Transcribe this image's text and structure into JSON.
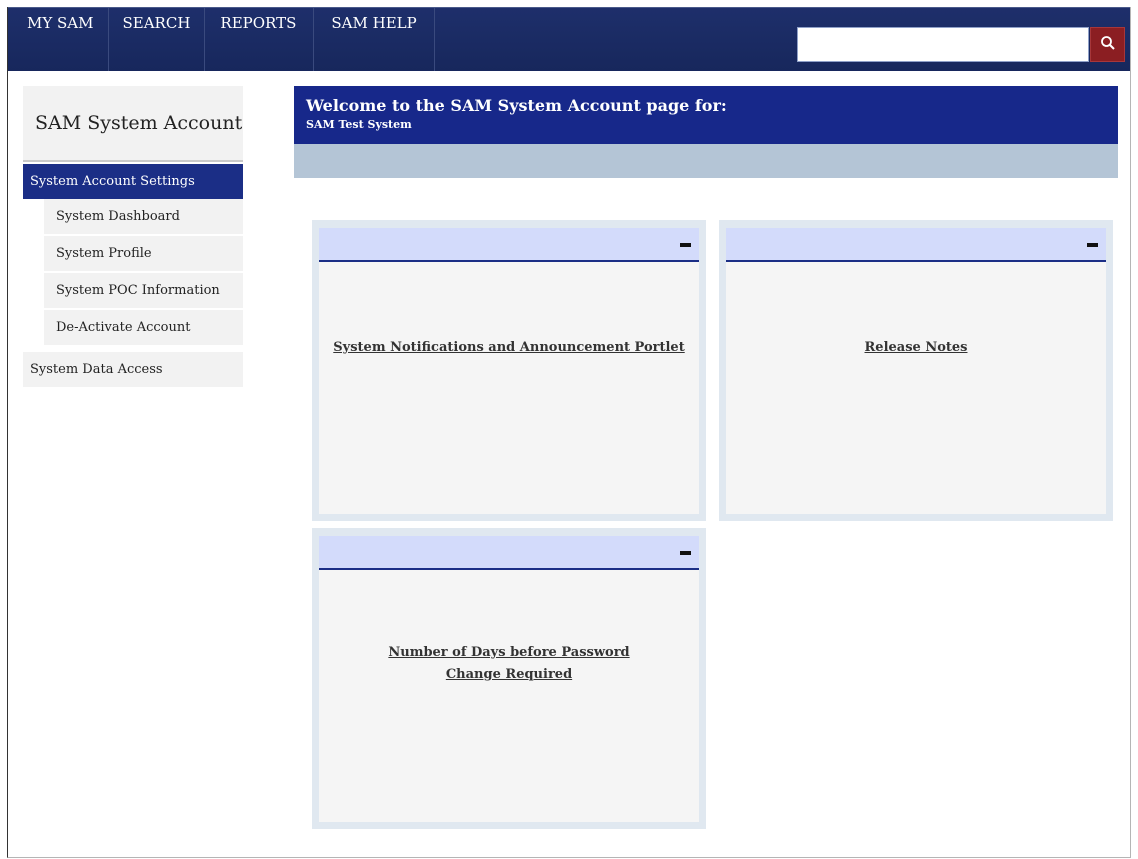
{
  "nav": {
    "items": [
      {
        "label": "MY SAM"
      },
      {
        "label": "SEARCH"
      },
      {
        "label": "REPORTS"
      },
      {
        "label": "SAM HELP"
      }
    ],
    "active_index": 0
  },
  "search": {
    "placeholder": "",
    "value": "",
    "icon": "search-icon"
  },
  "sidebar": {
    "title": "SAM System Account",
    "section_active": "System Account Settings",
    "sub_items": [
      {
        "label": "System Dashboard"
      },
      {
        "label": "System Profile"
      },
      {
        "label": "System POC Information"
      },
      {
        "label": "De-Activate Account"
      }
    ],
    "section_other": "System Data Access"
  },
  "welcome": {
    "heading": "Welcome to the SAM System Account page for:",
    "system_name": "SAM Test System"
  },
  "portlets": [
    {
      "title": "System Notifications and Announcement Portlet"
    },
    {
      "title": "Release Notes"
    },
    {
      "title": "Number of Days before Password Change Required"
    }
  ],
  "colors": {
    "nav_bg": "#1e2f6b",
    "accent_blue": "#17288a",
    "search_button": "#8b1e22",
    "portlet_header": "#d3dbfb"
  }
}
